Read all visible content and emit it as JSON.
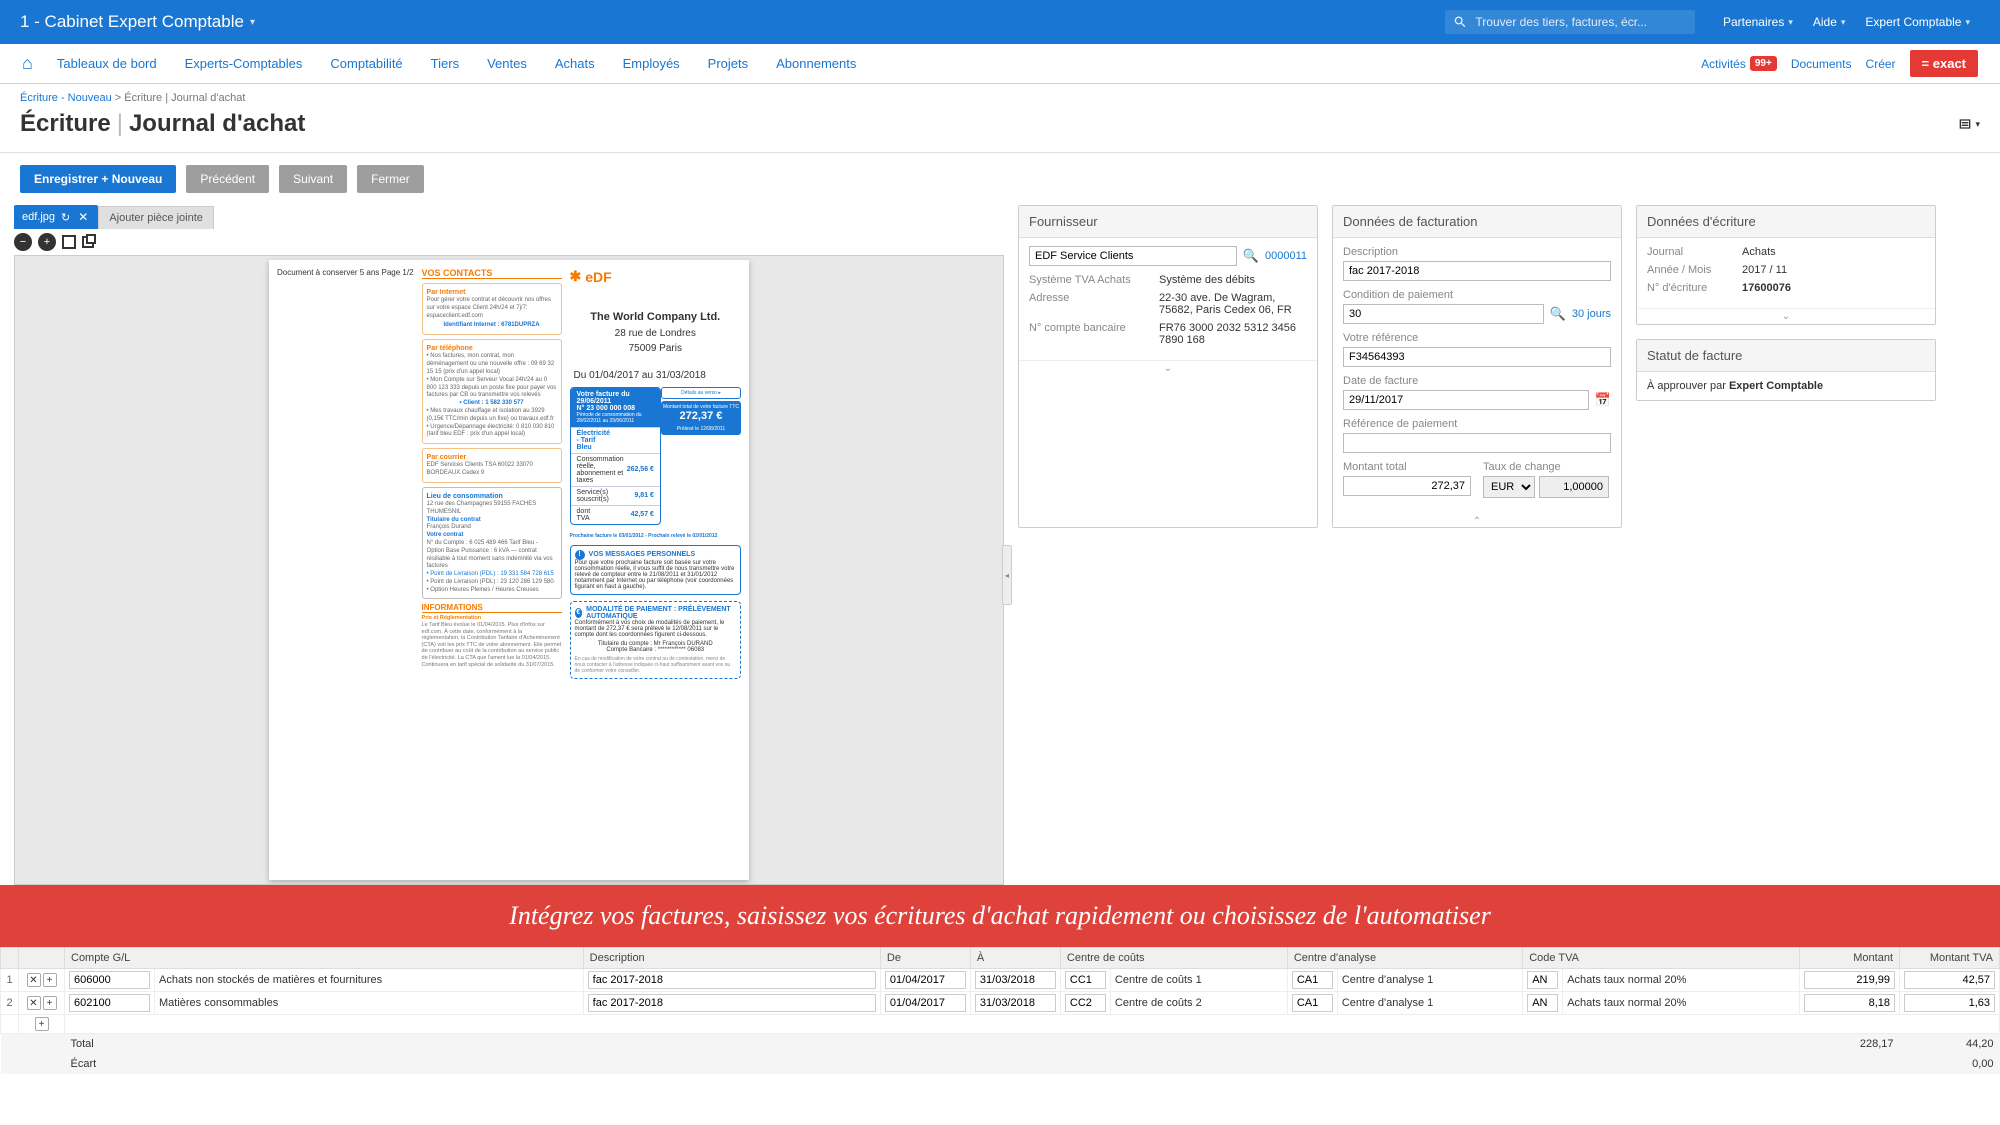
{
  "topbar": {
    "company": "1 - Cabinet Expert Comptable",
    "search_placeholder": "Trouver des tiers, factures, écr...",
    "partenaires": "Partenaires",
    "aide": "Aide",
    "user": "Expert Comptable"
  },
  "nav": {
    "items": [
      "Tableaux de bord",
      "Experts-Comptables",
      "Comptabilité",
      "Tiers",
      "Ventes",
      "Achats",
      "Employés",
      "Projets",
      "Abonnements"
    ],
    "activites": "Activités",
    "badge": "99+",
    "documents": "Documents",
    "creer": "Créer",
    "exact": "= exact"
  },
  "breadcrumb": {
    "link": "Écriture - Nouveau",
    "tail": "Écriture | Journal d'achat"
  },
  "title": {
    "main": "Écriture",
    "sub": "Journal d'achat"
  },
  "buttons": {
    "save": "Enregistrer + Nouveau",
    "prev": "Précédent",
    "next": "Suivant",
    "close": "Fermer"
  },
  "attach": {
    "file": "edf.jpg",
    "add": "Ajouter pièce jointe"
  },
  "doc": {
    "top_note": "Document à conserver 5 ans       Page 1/2",
    "logo": "eDF",
    "contacts_hd": "VOS CONTACTS",
    "internet_t": "Par Internet",
    "internet_b": "Pour gérer votre contrat et découvrir nos offres sur votre espace Client 24h/24 et 7j/7: espaceclient.edf.com",
    "internet_id": "Identifiant Internet : 6781DUPRZA",
    "tel_t": "Par téléphone",
    "tel_b1": "• Nos factures, mon contrat, mon déménagement ou une nouvelle offre : 09 69 32 15 15 (prix d'un appel local)",
    "tel_b2": "• Mon Compte sur Serveur Vocal 24h/24 au 0 800 123 333 depuis un poste fixe pour payer vos factures par CB ou transmettre vos relevés",
    "tel_b3": "• Client : 1 582 330 577",
    "tel_b4": "• Mes travaux chauffage et isolation au 3929 (0,15€ TTC/min depuis un fixe) ou travaux.edf.fr",
    "tel_b5": "• Urgence/Dépannage électricité: 0 810 030 810 (tarif bleu EDF : prix d'un appel local)",
    "courrier_t": "Par courrier",
    "courrier_b": "EDF Services Clients TSA 60022 33070 BORDEAUX Cedex 9",
    "lieu_t": "Lieu de consommation",
    "lieu_b": "12 rue des Champagnes 59155 FACHES THUMESNIL",
    "contrat_hd": "Titulaire du contrat",
    "contrat_nm": "François Durand",
    "votre_contrat": "Votre contrat",
    "contrat_det": "N° du Compte : 6 025 489 466 Tarif Bleu - Option Base Puissance : 6 kVA — contrat résiliable à tout moment sans indemnité via vos factures",
    "contrat_l1": "• Point de Livraison (PDL) : 19 331 584 728 615",
    "contrat_l2": "• Point de Livraison (PDL) : 23 120 286 129 580",
    "contrat_l3": "• Option Heures Pleines / Heures Creuses",
    "info_hd": "INFORMATIONS",
    "info_t": "Prix et Réglementation",
    "info_b": "Le Tarif Bleu évolue le 01/04/2015. Plus d'infos sur edf.com. À cette date, conformément à la réglementation, la Contribution Tarifaire d'Acheminement (CTA) voit les prix TTC de votre abonnement. Elle permet de contribuer au coût de la contribution au service public de l'électricité. La CTA que l'ament lue la 01/04/2015. Continuera en tarif spécial de solidarité du 31/07/2015.",
    "company": "The World Company Ltd.",
    "addr1": "28 rue de Londres",
    "addr2": "75009 Paris",
    "period": "Du 01/04/2017 au 31/03/2018",
    "fb_hd1": "Votre facture du 29/06/2011",
    "fb_hd2": "N° 23 000 000 008",
    "fb_sub": "Période de consommation du 28/02/2011 au 29/06/2011",
    "fb_r1_l": "Électricité - Tarif Bleu",
    "fb_r2_l": "Consommation réelle, abonnement et taxes",
    "fb_r2_v": "262,56 €",
    "fb_r3_l": "Service(s) souscrit(s)",
    "fb_r3_v": "9,81 €",
    "fb_r4_l": "dont TVA",
    "fb_r4_v": "42,57 €",
    "fb_det": "Détails au verso",
    "fb_tot_l": "Montant total de votre facture TTC",
    "fb_tot_v": "272,37 €",
    "fb_prel": "Prélevé le 12/08/2011",
    "fb_foot": "Prochaine facture le 03/01/2012 - Prochain relevé le 02/01/2012",
    "msg_hd": "VOS MESSAGES PERSONNELS",
    "msg_b": "Pour que votre prochaine facture soit basée sur votre consommation réelle, il vous suffit de nous transmettre votre relevé de compteur entre le 21/08/2011 et 31/01/2012 notamment par Internet ou par téléphone (voir coordonnées figurant en haut à gauche).",
    "pay_hd": "MODALITÉ DE PAIEMENT : PRÉLÈVEMENT AUTOMATIQUE",
    "pay_b": "Conformément à vos choix de modalités de paiement, le montant de 272,37 € sera prélevé le 12/08/2011 sur le compte dont les coordonnées figurent ci-dessous.",
    "pay_c1": "Titulaire du compte : Mr François DURAND",
    "pay_c2": "Compte Bancaire : ************ 06083",
    "pay_foot": "En cas de modification de votre contrat ou de contestation, merci de nous contacter à l'adresse indiquée ci-haut suffisamment avant vos ou de conformer votre conseiller."
  },
  "supplier": {
    "title": "Fournisseur",
    "name_val": "EDF Service Clients",
    "code": "0000011",
    "vat_label": "Système TVA Achats",
    "vat_val": "Système des débits",
    "addr_label": "Adresse",
    "addr_val": "22-30 ave. De Wagram, 75682, Paris Cedex 06, FR",
    "bank_label": "N° compte bancaire",
    "bank_val": "FR76 3000 2032 5312 3456 7890 168"
  },
  "invoice": {
    "title": "Données de facturation",
    "desc_label": "Description",
    "desc_val": "fac 2017-2018",
    "cond_label": "Condition de paiement",
    "cond_val": "30",
    "cond_link": "30 jours",
    "ref_label": "Votre référence",
    "ref_val": "F34564393",
    "date_label": "Date de facture",
    "date_val": "29/11/2017",
    "payref_label": "Référence de paiement",
    "payref_val": "",
    "total_label": "Montant total",
    "total_val": "272,37",
    "rate_label": "Taux de change",
    "rate_cur": "EUR",
    "rate_val": "1,00000"
  },
  "entry": {
    "title": "Données d'écriture",
    "journal_label": "Journal",
    "journal_val": "Achats",
    "period_label": "Année / Mois",
    "period_val": "2017 / 11",
    "num_label": "N° d'écriture",
    "num_val": "17600076"
  },
  "status": {
    "title": "Statut de facture",
    "text": "À approuver par",
    "who": "Expert Comptable"
  },
  "banner": "Intégrez vos factures, saisissez vos écritures d'achat rapidement ou choisissez de l'automatiser",
  "grid": {
    "headers": {
      "gl": "Compte G/L",
      "desc": "Description",
      "from": "De",
      "to": "À",
      "cc": "Centre de coûts",
      "ca": "Centre d'analyse",
      "tva": "Code TVA",
      "amount": "Montant",
      "amount_tva": "Montant TVA"
    },
    "rows": [
      {
        "n": "1",
        "gl": "606000",
        "gl_name": "Achats non stockés de matières et fournitures",
        "desc": "fac 2017-2018",
        "from": "01/04/2017",
        "to": "31/03/2018",
        "cc": "CC1",
        "cc_name": "Centre de coûts 1",
        "ca": "CA1",
        "ca_name": "Centre d'analyse 1",
        "tva": "AN",
        "tva_name": "Achats taux normal 20%",
        "amount": "219,99",
        "amount_tva": "42,57"
      },
      {
        "n": "2",
        "gl": "602100",
        "gl_name": "Matières consommables",
        "desc": "fac 2017-2018",
        "from": "01/04/2017",
        "to": "31/03/2018",
        "cc": "CC2",
        "cc_name": "Centre de coûts 2",
        "ca": "CA1",
        "ca_name": "Centre d'analyse 1",
        "tva": "AN",
        "tva_name": "Achats taux normal 20%",
        "amount": "8,18",
        "amount_tva": "1,63"
      }
    ],
    "total_label": "Total",
    "total_amount": "228,17",
    "total_tva": "44,20",
    "ecart_label": "Écart",
    "ecart_amount": "",
    "ecart_tva": "0,00"
  }
}
